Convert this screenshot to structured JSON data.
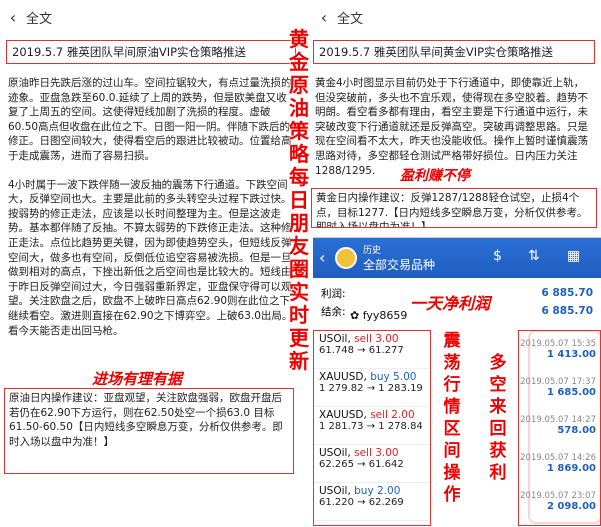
{
  "left": {
    "back_icon": "chevron-left",
    "nav_title": "全文",
    "post_title": "2019.5.7  雅英团队早间原油VIP实仓策略推送",
    "para1": "原油昨日先跌后涨的过山车。空间拉锯较大，有点过量洗损的迹象。亚盘急跌至60.0.延续了上周的跌势，但是欧美盘又收复了上周五的空间。这使得短线加剧了洗损的程度。虚破60.50高点但收盘在此位之下。日图一阳一阴。伴随下跌后的修正。日图空间较大，使得看空后的跟进比较被动。位置给高于走成震荡，进而了容易扫损。",
    "para2": "4小时属于一波下跌伴随一波反抽的震荡下行通道。下跌空间大，反弹空间也大。主要是此前的多头转空头过程下跌过快。按弱势的修正走法，应该是以长时间整理为主。但是这波走势。基本都伴随了反抽。不算太弱势的下跌修正走法。这种修正走法。点位比趋势更关键，因为即使趋势空头，但短线反弹空间大，做多也有空间，反倒低位追空容易被洗损。但是一旦做到相对的高点，下挫出新低之后空间也是比较大的。短线由于昨日反弹空间过大，今日强弱重新界定，亚盘保守得可以观望。关注欧盘之后，欧盘不上破昨日高点62.90则在此位之下继续看空。激进则直接在62.90之下博弈空。上破63.0出局。看今天能否走出回马枪。",
    "callout": "进场有理有据",
    "strategy_text": "原油日内操作建议：亚盘观望，关注欧盘强弱，欧盘开盘后若仍在62.90下方运行，则在62.50处空一个损63.0  目标61.50-60.50【日内短线多空瞬息万变，分析仅供参考。即时入场以盘中为准！】"
  },
  "banner": "黄金原油策略每日朋友圈实时更新",
  "right": {
    "back_icon": "chevron-left",
    "nav_title": "全文",
    "post_title": "2019.5.7  雅英团队早间黄金VIP实仓策略推送",
    "para1": "黄金4小时图显示目前仍处于下行通道中，即使靠近上轨，但没突破前，多头也不宜乐观，使得现在多空胶着。趋势不明朗。看空看多都有理由，看空主要是下行通道中运行，未突破改变下行通道就还是反弹高空。突破再调整思路。只是现在空间看不太大，昨天也没能收低。操作上暂时谨慎震荡思路对待，多空都轻仓测试严格带好损位。日内压力关注1288/1295.",
    "callout": "盈利赚不停",
    "strategy_text": "黄金日内操作建议：反弹1287/1288轻仓试空，止损4个点，目标1277.【日内短线多空瞬息万变，分析仅供参考。即时入场以盘中为准！】"
  },
  "app": {
    "header_sub": "历史",
    "header_title": "全部交易品种",
    "icons": [
      "back-icon",
      "logo-icon",
      "exchange-icon",
      "sort-icon",
      "calendar-icon"
    ],
    "profit_label": "利润:",
    "profit_value": "6 885.70",
    "balance_label": "结余:",
    "balance_value": "6 885.70",
    "wechat_id": "fyy8659",
    "profit_banner": "一天净利润",
    "vert_left": "震荡行情区间操作",
    "vert_right": "多空来回获利",
    "orders": [
      {
        "symbol": "USOil,",
        "side": "sell",
        "qty": "3.00",
        "prices": "61.748 → 61.277",
        "date": "2019.05.07 15:35",
        "profit": "1 413.00"
      },
      {
        "symbol": "XAUUSD,",
        "side": "buy",
        "qty": "5.00",
        "prices": "1 279.82 → 1 283.19",
        "date": "2019.05.07 17:37",
        "profit": "1 685.00"
      },
      {
        "symbol": "XAUUSD,",
        "side": "sell",
        "qty": "2.00",
        "prices": "1 281.73 → 1 278.84",
        "date": "2019.05.07 14:27",
        "profit": "578.00"
      },
      {
        "symbol": "USOil,",
        "side": "sell",
        "qty": "3.00",
        "prices": "62.265 → 61.642",
        "date": "2019.05.07 14:26",
        "profit": "1 869.00"
      },
      {
        "symbol": "USOil,",
        "side": "buy",
        "qty": "2.00",
        "prices": "61.220 → 62.269",
        "date": "2019.05.07 23:07",
        "profit": "2 098.00"
      }
    ],
    "colors": {
      "header": "#1f5ec0",
      "profit": "#1e5fbf",
      "sell": "#d22",
      "accent_red": "#e00"
    }
  }
}
